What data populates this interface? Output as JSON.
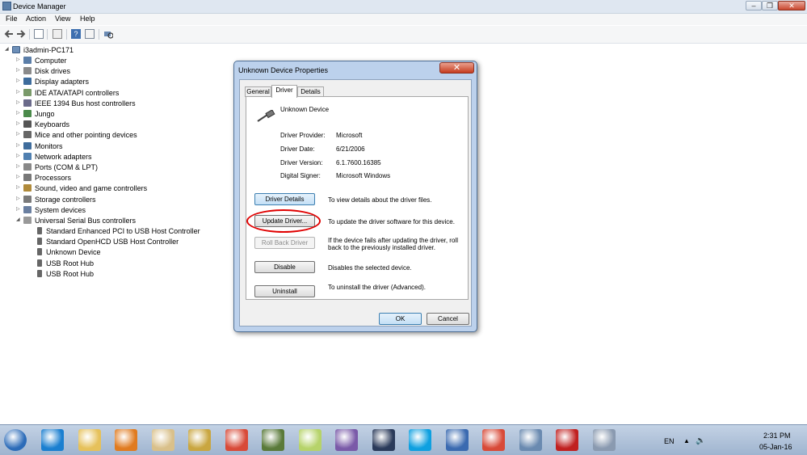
{
  "window": {
    "title": "Device Manager",
    "colors": {
      "titlebar": "#dfe7f1",
      "dialog_frame": "#bcd1ec",
      "highlight": "#e00000"
    }
  },
  "menu": [
    "File",
    "Action",
    "View",
    "Help"
  ],
  "toolbar_icons": [
    "back-arrow-icon",
    "forward-arrow-icon",
    "console-tree-icon",
    "properties-icon",
    "help-icon",
    "action-pane-icon",
    "scan-hardware-icon"
  ],
  "tree": {
    "root": "i3admin-PC171",
    "categories": [
      "Computer",
      "Disk drives",
      "Display adapters",
      "IDE ATA/ATAPI controllers",
      "IEEE 1394 Bus host controllers",
      "Jungo",
      "Keyboards",
      "Mice and other pointing devices",
      "Monitors",
      "Network adapters",
      "Ports (COM & LPT)",
      "Processors",
      "Sound, video and game controllers",
      "Storage controllers",
      "System devices",
      "Universal Serial Bus controllers"
    ],
    "usb_children": [
      "Standard Enhanced PCI to USB Host Controller",
      "Standard OpenHCD USB Host Controller",
      "Unknown Device",
      "USB Root Hub",
      "USB Root Hub"
    ]
  },
  "dialog": {
    "title": "Unknown Device Properties",
    "close": "✕",
    "tabs": [
      "General",
      "Driver",
      "Details"
    ],
    "device_name": "Unknown Device",
    "fields": [
      {
        "label": "Driver Provider:",
        "value": "Microsoft"
      },
      {
        "label": "Driver Date:",
        "value": "6/21/2006"
      },
      {
        "label": "Driver Version:",
        "value": "6.1.7600.16385"
      },
      {
        "label": "Digital Signer:",
        "value": "Microsoft Windows"
      }
    ],
    "actions": [
      {
        "button": "Driver Details",
        "desc": "To view details about the driver files."
      },
      {
        "button": "Update Driver...",
        "desc": "To update the driver software for this device."
      },
      {
        "button": "Roll Back Driver",
        "desc": "If the device fails after updating the driver, roll back to the previously installed driver.",
        "desc_line1": "If the device fails after updating the driver, roll",
        "desc_line2": "back to the previously installed driver."
      },
      {
        "button": "Disable",
        "desc": "Disables the selected device."
      },
      {
        "button": "Uninstall",
        "desc": "To uninstall the driver (Advanced)."
      }
    ],
    "ok": "OK",
    "cancel": "Cancel"
  },
  "taskbar": {
    "apps": [
      "start-orb-icon",
      "internet-explorer-icon",
      "file-explorer-icon",
      "media-player-icon",
      "paint-icon",
      "notepad-icon",
      "chrome-icon",
      "tools-icon",
      "folder-icon",
      "media-icon",
      "camera-icon",
      "skype-icon",
      "thunderbird-icon",
      "chrome-icon",
      "control-panel-icon",
      "toolbox-icon",
      "device-manager-icon"
    ],
    "language": "EN",
    "time": "2:31 PM",
    "date": "05-Jan-16"
  }
}
